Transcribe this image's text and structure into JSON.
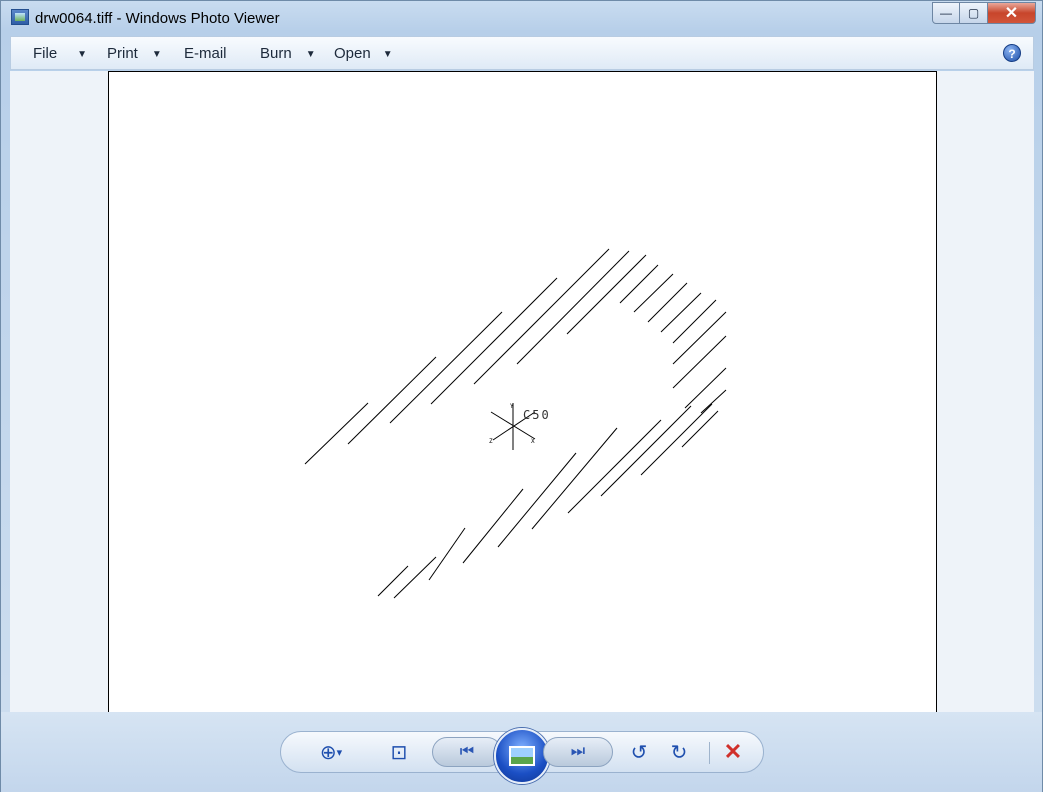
{
  "window": {
    "title": "drw0064.tiff - Windows Photo Viewer",
    "controls": {
      "minimize": "—",
      "maximize": "▢",
      "close": "✕"
    }
  },
  "menu": {
    "items": [
      {
        "label": "File",
        "has_dropdown": true
      },
      {
        "label": "Print",
        "has_dropdown": true
      },
      {
        "label": "E-mail",
        "has_dropdown": false
      },
      {
        "label": "Burn",
        "has_dropdown": true
      },
      {
        "label": "Open",
        "has_dropdown": true
      }
    ],
    "help": "?"
  },
  "image": {
    "drawing_label": "C50",
    "triad_labels": {
      "y": "Y",
      "z": "Z",
      "x": "X"
    }
  },
  "playback": {
    "icons": [
      "zoom-icon",
      "actual-size-icon",
      "previous-icon",
      "slideshow-icon",
      "next-icon",
      "rotate-counterclockwise-icon",
      "rotate-clockwise-icon",
      "delete-icon"
    ],
    "zoom_caret": "▾"
  },
  "colors": {
    "delete": "#d0302b",
    "accent": "#1f4fae"
  }
}
